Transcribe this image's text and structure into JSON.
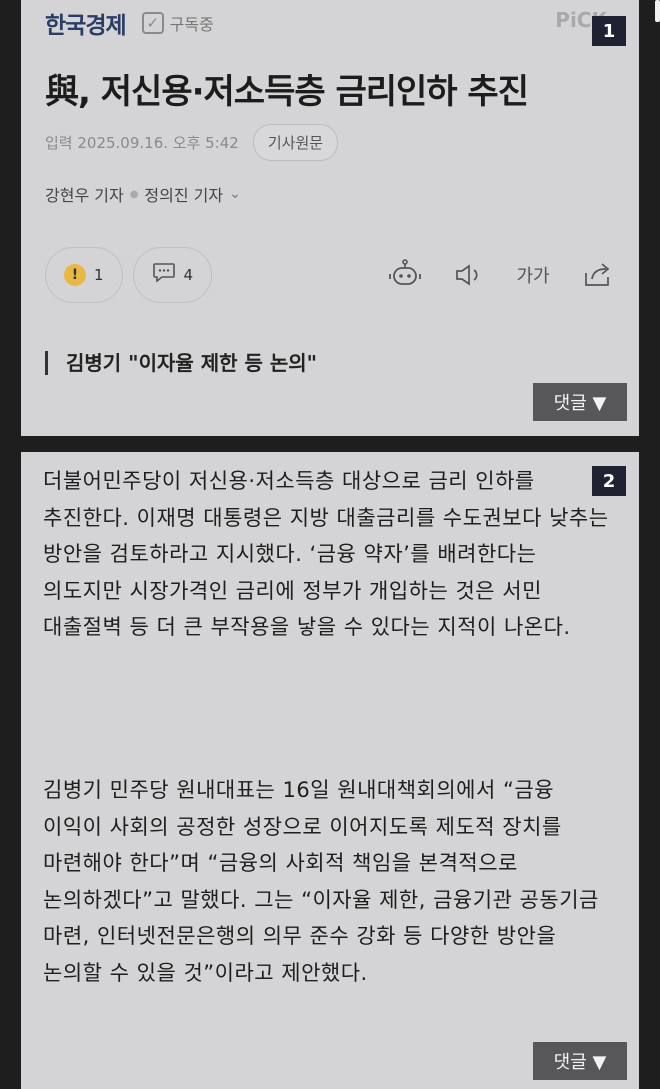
{
  "article": {
    "press": "한국경제",
    "subscribe_label": "구독중",
    "pick_label": "PiCK",
    "headline": "與, 저신용·저소득층 금리인하 추진",
    "date": "입력 2025.09.16. 오후 5:42",
    "original_button": "기사원문",
    "reporters": [
      "강현우 기자",
      "정의진 기자"
    ],
    "reaction_count": "1",
    "comment_count": "4",
    "font_size_label": "가가",
    "subtitle": "김병기 \"이자율 제한 등 논의\"",
    "reply_label": "댓글 ▼"
  },
  "badges": [
    "1",
    "2"
  ],
  "body": {
    "paragraph1": "더불어민주당이 저신용·저소득층 대상으로 금리 인하를 추진한다. 이재명 대통령은 지방 대출금리를 수도권보다 낮추는 방안을 검토하라고 지시했다. ‘금융 약자’를 배려한다는 의도지만 시장가격인 금리에 정부가 개입하는 것은 서민 대출절벽 등 더 큰 부작용을 낳을 수 있다는 지적이 나온다.",
    "paragraph2": "김병기 민주당 원내대표는 16일 원내대책회의에서 “금융 이익이 사회의 공정한 성장으로 이어지도록 제도적 장치를 마련해야 한다”며 “금융의 사회적 책임을 본격적으로 논의하겠다”고 말했다. 그는 “이자율 제한, 금융기관 공동기금 마련, 인터넷전문은행의 의무 준수 강화 등 다양한 방안을 논의할 수 있을 것”이라고 제안했다."
  },
  "colors": {
    "background": "#1e1e1e",
    "card": "#d4d4d6",
    "press": "#2b3d66",
    "badge": "#1e2233",
    "reply_button": "#575759"
  }
}
